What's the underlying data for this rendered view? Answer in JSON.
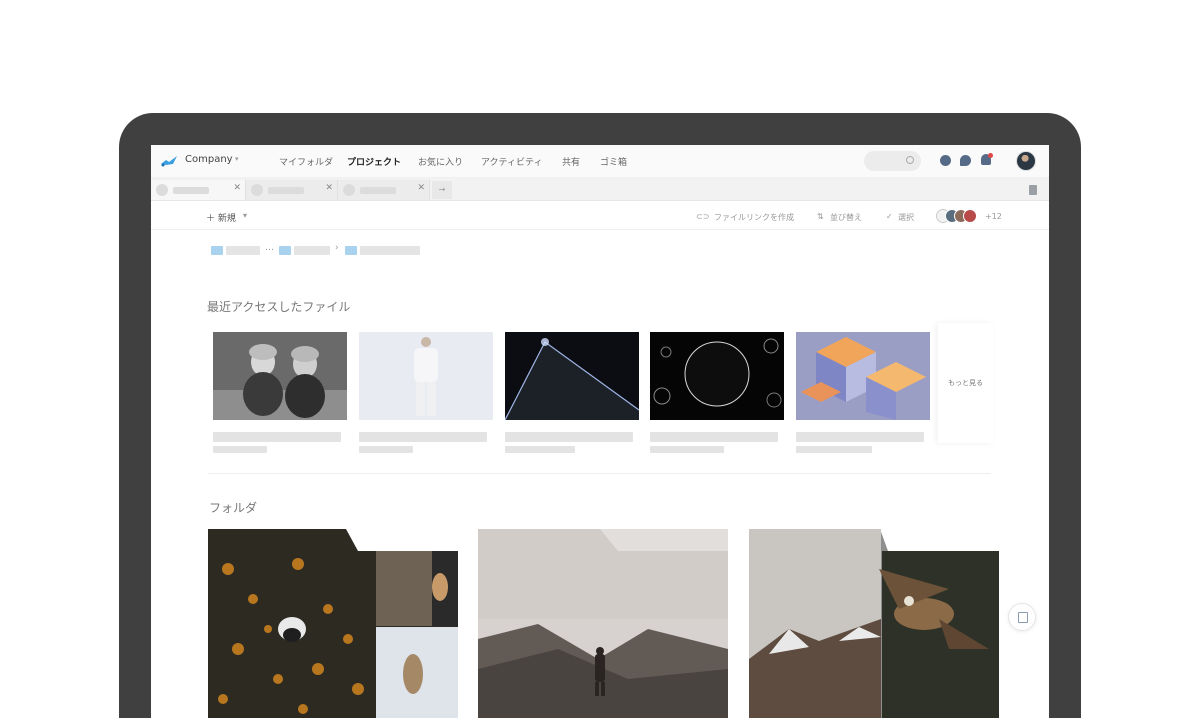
{
  "topbar": {
    "company": "Company",
    "nav": [
      "マイフォルダ",
      "プロジェクト",
      "お気に入り",
      "アクティビティ",
      "共有",
      "ゴミ箱"
    ],
    "active_nav": "プロジェクト"
  },
  "toolbar": {
    "new_label": "＋ 新規",
    "create_link": "ファイルリンクを作成",
    "sort": "並び替え",
    "select": "選択",
    "members_more": "+12"
  },
  "recent": {
    "title": "最近アクセスしたファイル",
    "more_label": "もっと見る"
  },
  "folders": {
    "title": "フォルダ"
  },
  "colors": {
    "frame": "#404040",
    "icon": "#556a86",
    "folder_icon": "#a9d2ee",
    "notification": "#e04646"
  }
}
